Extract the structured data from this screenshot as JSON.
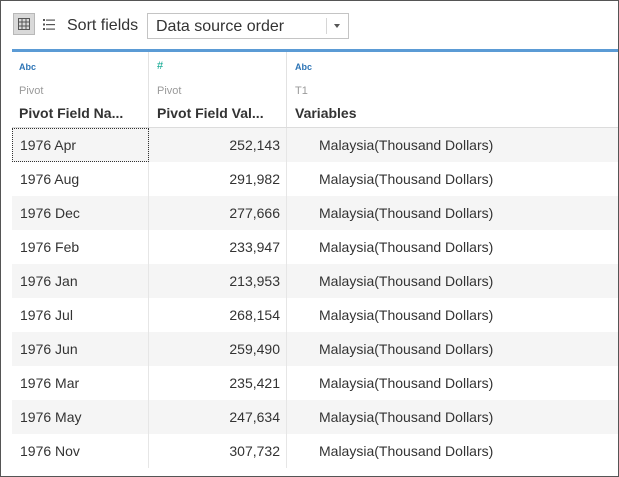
{
  "toolbar": {
    "grid_view_icon": "grid-icon",
    "list_view_icon": "list-icon",
    "sort_label": "Sort fields",
    "sort_value": "Data source order"
  },
  "columns": [
    {
      "type_icon": "Abc",
      "source": "Pivot",
      "name": "Pivot Field Na..."
    },
    {
      "type_icon": "#",
      "source": "Pivot",
      "name": "Pivot Field Val..."
    },
    {
      "type_icon": "Abc",
      "source": "T1",
      "name": "Variables"
    }
  ],
  "rows": [
    {
      "name": "1976 Apr",
      "value": "252,143",
      "variable": "Malaysia(Thousand Dollars)"
    },
    {
      "name": "1976 Aug",
      "value": "291,982",
      "variable": "Malaysia(Thousand Dollars)"
    },
    {
      "name": "1976 Dec",
      "value": "277,666",
      "variable": "Malaysia(Thousand Dollars)"
    },
    {
      "name": "1976 Feb",
      "value": "233,947",
      "variable": "Malaysia(Thousand Dollars)"
    },
    {
      "name": "1976 Jan",
      "value": "213,953",
      "variable": "Malaysia(Thousand Dollars)"
    },
    {
      "name": "1976 Jul",
      "value": "268,154",
      "variable": "Malaysia(Thousand Dollars)"
    },
    {
      "name": "1976 Jun",
      "value": "259,490",
      "variable": "Malaysia(Thousand Dollars)"
    },
    {
      "name": "1976 Mar",
      "value": "235,421",
      "variable": "Malaysia(Thousand Dollars)"
    },
    {
      "name": "1976 May",
      "value": "247,634",
      "variable": "Malaysia(Thousand Dollars)"
    },
    {
      "name": "1976 Nov",
      "value": "307,732",
      "variable": "Malaysia(Thousand Dollars)"
    }
  ],
  "colors": {
    "accent_line": "#5b9bd5",
    "string_type": "#2e75b6",
    "number_type": "#00a28a"
  }
}
